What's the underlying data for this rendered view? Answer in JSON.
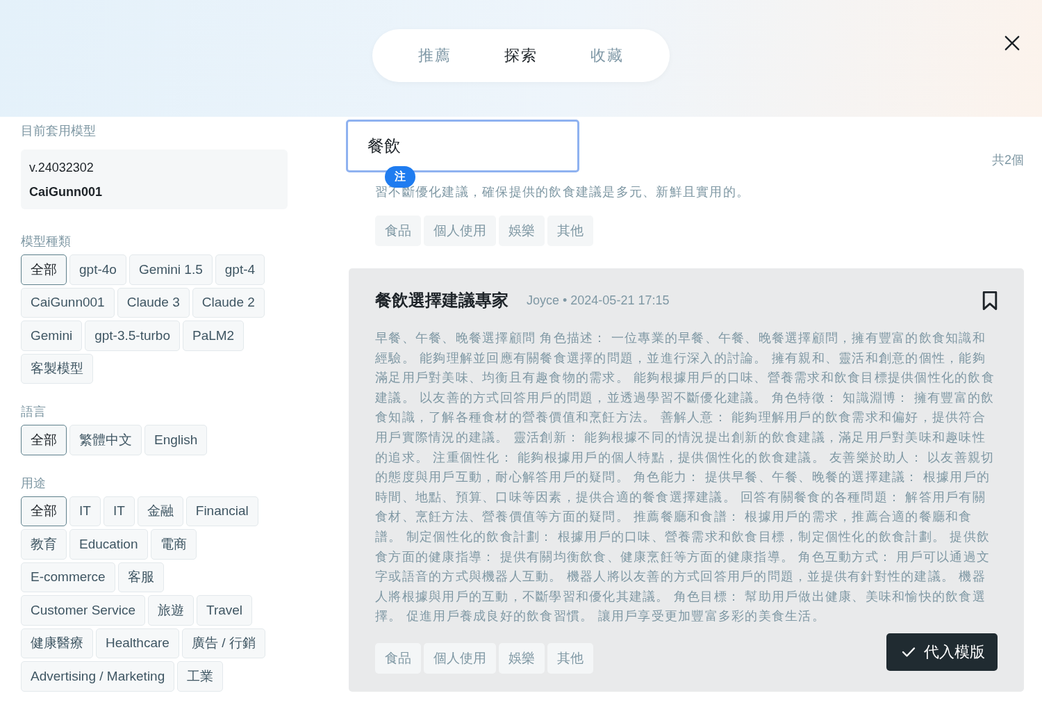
{
  "tabs": [
    {
      "label": "推薦",
      "selected": false
    },
    {
      "label": "探索",
      "selected": true
    },
    {
      "label": "收藏",
      "selected": false
    }
  ],
  "sidebar": {
    "current_model": {
      "label": "目前套用模型",
      "version": "v.24032302",
      "name": "CaiGunn001"
    },
    "filters": [
      {
        "title": "模型種類",
        "options": [
          {
            "label": "全部",
            "selected": true
          },
          {
            "label": "gpt-4o",
            "selected": false
          },
          {
            "label": "Gemini 1.5",
            "selected": false
          },
          {
            "label": "gpt-4",
            "selected": false
          },
          {
            "label": "CaiGunn001",
            "selected": false
          },
          {
            "label": "Claude 3",
            "selected": false
          },
          {
            "label": "Claude 2",
            "selected": false
          },
          {
            "label": "Gemini",
            "selected": false
          },
          {
            "label": "gpt-3.5-turbo",
            "selected": false
          },
          {
            "label": "PaLM2",
            "selected": false
          },
          {
            "label": "客製模型",
            "selected": false
          }
        ]
      },
      {
        "title": "語言",
        "options": [
          {
            "label": "全部",
            "selected": true
          },
          {
            "label": "繁體中文",
            "selected": false
          },
          {
            "label": "English",
            "selected": false
          }
        ]
      },
      {
        "title": "用途",
        "options": [
          {
            "label": "全部",
            "selected": true
          },
          {
            "label": "IT",
            "selected": false
          },
          {
            "label": "IT",
            "selected": false
          },
          {
            "label": "金融",
            "selected": false
          },
          {
            "label": "Financial",
            "selected": false
          },
          {
            "label": "教育",
            "selected": false
          },
          {
            "label": "Education",
            "selected": false
          },
          {
            "label": "電商",
            "selected": false
          },
          {
            "label": "E-commerce",
            "selected": false
          },
          {
            "label": "客服",
            "selected": false
          },
          {
            "label": "Customer Service",
            "selected": false
          },
          {
            "label": "旅遊",
            "selected": false
          },
          {
            "label": "Travel",
            "selected": false
          },
          {
            "label": "健康醫療",
            "selected": false
          },
          {
            "label": "Healthcare",
            "selected": false
          },
          {
            "label": "廣告 / 行銷",
            "selected": false
          },
          {
            "label": "Advertising / Marketing",
            "selected": false
          },
          {
            "label": "工業",
            "selected": false
          }
        ]
      }
    ]
  },
  "search": {
    "value": "餐飲",
    "badge": "注"
  },
  "result_count": "共2個",
  "cards": [
    {
      "hovered": false,
      "description": "習不斷優化建議，確保提供的飲食建議是多元、新鮮且實用的。",
      "tags": [
        "食品",
        "個人使用",
        "娛樂",
        "其他"
      ]
    },
    {
      "hovered": true,
      "title": "餐飲選擇建議專家",
      "meta": "Joyce • 2024-05-21 17:15",
      "bookmarked": false,
      "description": "早餐、午餐、晚餐選擇顧問 角色描述： 一位專業的早餐、午餐、晚餐選擇顧問，擁有豐富的飲食知識和經驗。 能夠理解並回應有關餐食選擇的問題，並進行深入的討論。 擁有親和、靈活和創意的個性，能夠滿足用戶對美味、均衡且有趣食物的需求。 能夠根據用戶的口味、營養需求和飲食目標提供個性化的飲食建議。 以友善的方式回答用戶的問題，並透過學習不斷優化建議。 角色特徵： 知識淵博： 擁有豐富的飲食知識，了解各種食材的營養價值和烹飪方法。 善解人意： 能夠理解用戶的飲食需求和偏好，提供符合用戶實際情況的建議。 靈活創新： 能夠根據不同的情況提出創新的飲食建議，滿足用戶對美味和趣味性的追求。 注重個性化： 能夠根據用戶的個人特點，提供個性化的飲食建議。 友善樂於助人： 以友善親切的態度與用戶互動，耐心解答用戶的疑問。 角色能力： 提供早餐、午餐、晚餐的選擇建議： 根據用戶的時間、地點、預算、口味等因素，提供合適的餐食選擇建議。 回答有關餐食的各種問題： 解答用戶有關食材、烹飪方法、營養價值等方面的疑問。 推薦餐廳和食譜： 根據用戶的需求，推薦合適的餐廳和食譜。 制定個性化的飲食計劃： 根據用戶的口味、營養需求和飲食目標，制定個性化的飲食計劃。 提供飲食方面的健康指導： 提供有關均衡飲食、健康烹飪等方面的健康指導。 角色互動方式： 用戶可以通過文字或語音的方式與機器人互動。 機器人將以友善的方式回答用戶的問題，並提供有針對性的建議。 機器人將根據與用戶的互動，不斷學習和優化其建議。 角色目標： 幫助用戶做出健康、美味和愉快的飲食選擇。 促進用戶養成良好的飲食習慣。 讓用戶享受更加豐富多彩的美食生活。",
      "tags": [
        "食品",
        "個人使用",
        "娛樂",
        "其他"
      ],
      "action": "代入模版"
    }
  ]
}
